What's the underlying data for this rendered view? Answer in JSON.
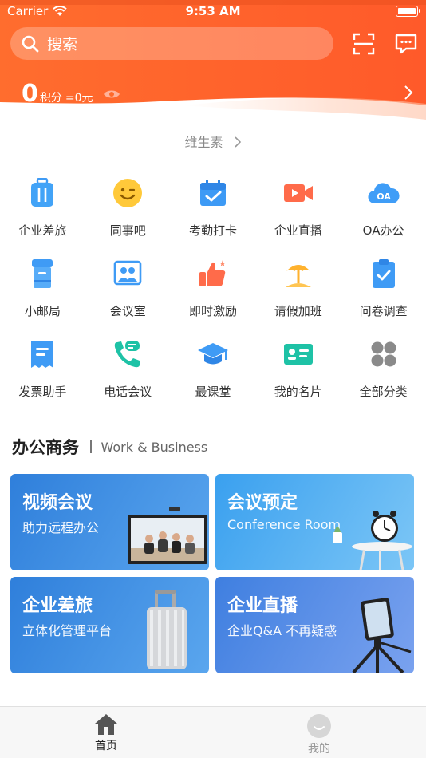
{
  "status_bar": {
    "carrier": "Carrier",
    "time": "9:53 AM"
  },
  "header": {
    "search_placeholder": "搜索",
    "points_value": "0",
    "points_unit": "积分",
    "points_money": "=0元",
    "accent_color": "#ff6a2b"
  },
  "vitamin": {
    "label": "维生素"
  },
  "apps": [
    {
      "label": "企业差旅",
      "icon": "suitcase-icon"
    },
    {
      "label": "同事吧",
      "icon": "smiley-icon"
    },
    {
      "label": "考勤打卡",
      "icon": "calendar-check-icon"
    },
    {
      "label": "企业直播",
      "icon": "video-camera-icon"
    },
    {
      "label": "OA办公",
      "icon": "oa-cloud-icon"
    },
    {
      "label": "小邮局",
      "icon": "mailbox-icon"
    },
    {
      "label": "会议室",
      "icon": "meeting-room-icon"
    },
    {
      "label": "即时激励",
      "icon": "thumbs-up-icon"
    },
    {
      "label": "请假加班",
      "icon": "beach-umbrella-icon"
    },
    {
      "label": "问卷调查",
      "icon": "clipboard-check-icon"
    },
    {
      "label": "发票助手",
      "icon": "invoice-icon"
    },
    {
      "label": "电话会议",
      "icon": "phone-chat-icon"
    },
    {
      "label": "最课堂",
      "icon": "graduation-cap-icon"
    },
    {
      "label": "我的名片",
      "icon": "business-card-icon"
    },
    {
      "label": "全部分类",
      "icon": "all-categories-icon"
    }
  ],
  "section": {
    "title_cn": "办公商务",
    "title_en": "Work & Business"
  },
  "cards": [
    {
      "title": "视频会议",
      "subtitle": "助力远程办公"
    },
    {
      "title": "会议预定",
      "subtitle": "Conference Room"
    },
    {
      "title": "企业差旅",
      "subtitle": "立体化管理平台"
    },
    {
      "title": "企业直播",
      "subtitle": "企业Q&A 不再疑惑"
    }
  ],
  "tabbar": {
    "home_label": "首页",
    "mine_label": "我的"
  }
}
